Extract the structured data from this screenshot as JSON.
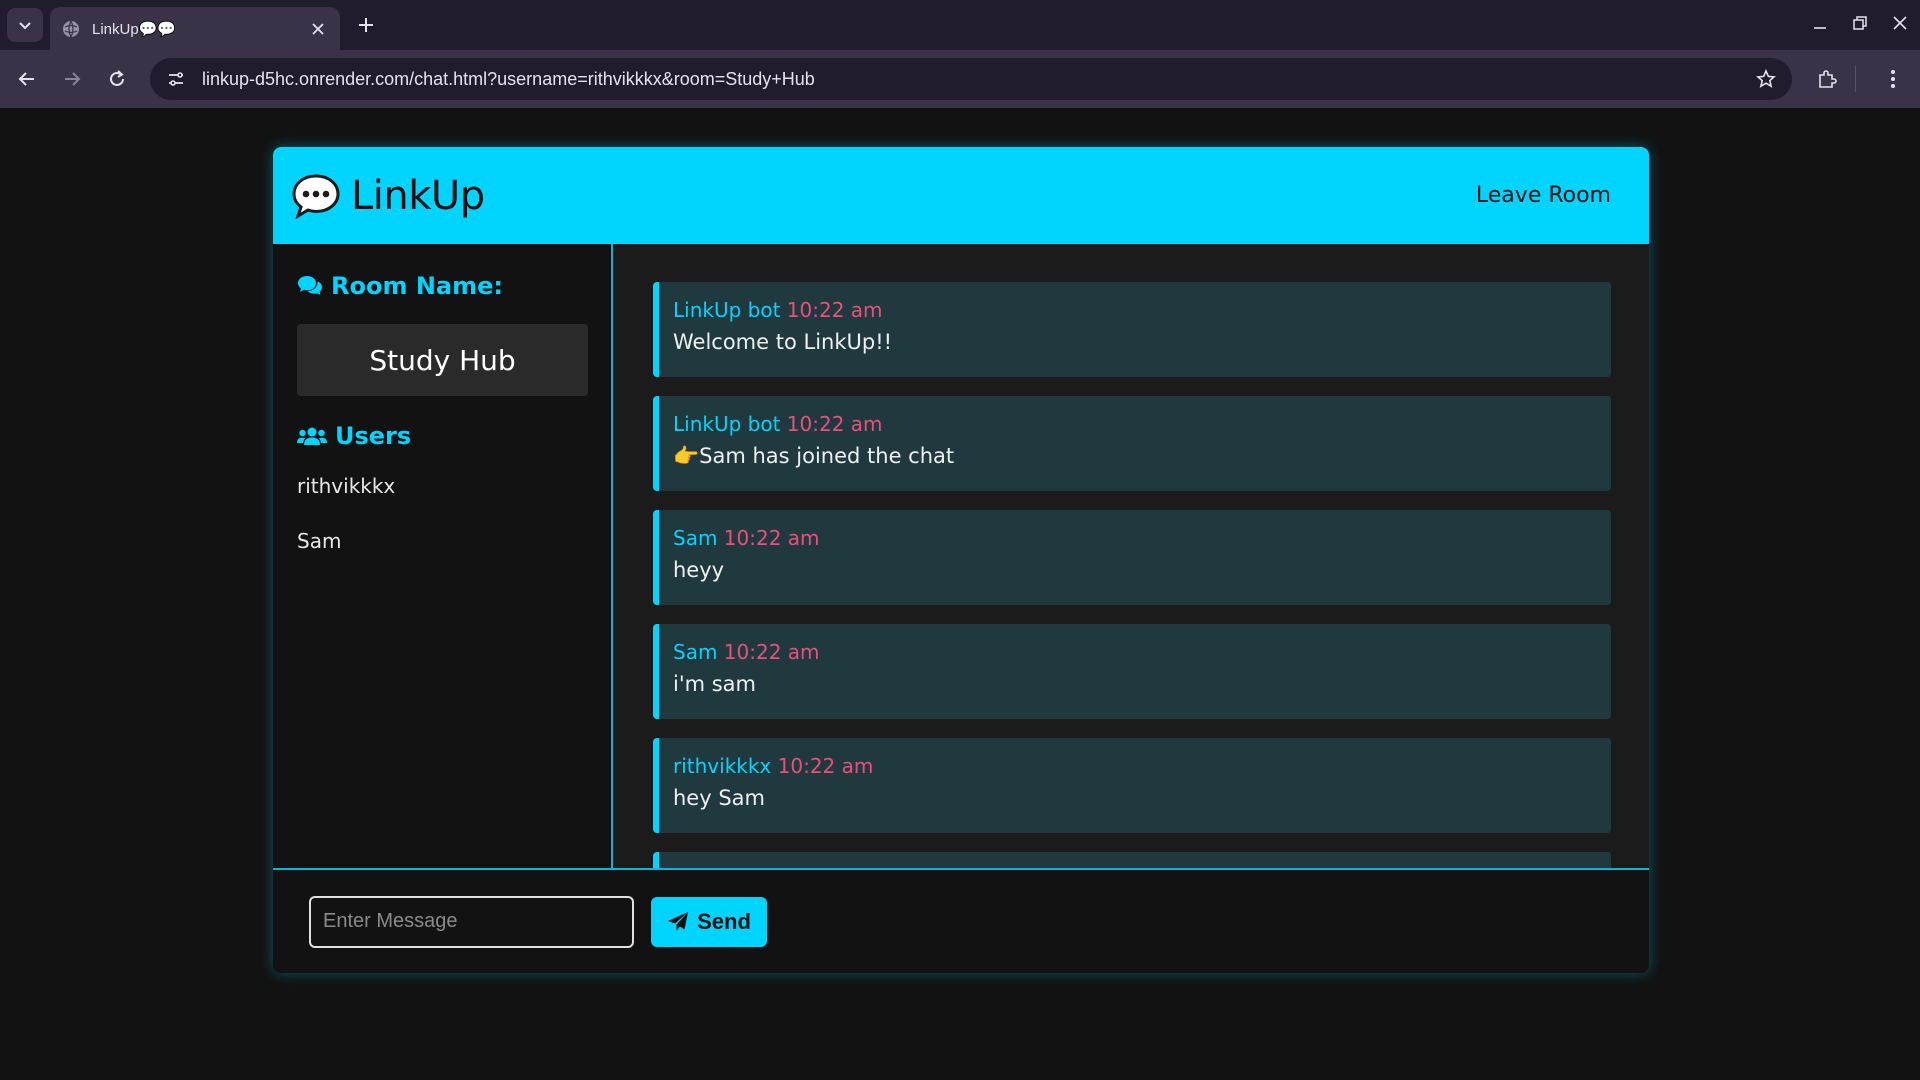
{
  "browser": {
    "tab_title": "LinkUp💬💬",
    "url": "linkup-d5hc.onrender.com/chat.html?username=rithvikkkx&room=Study+Hub"
  },
  "app": {
    "title": "LinkUp",
    "leave_label": "Leave Room",
    "accent_color": "#00d4ff",
    "time_color": "#ec4f7b"
  },
  "sidebar": {
    "room_heading": "Room Name:",
    "room_name": "Study Hub",
    "users_heading": "Users",
    "users": [
      "rithvikkkx",
      "Sam"
    ]
  },
  "messages": [
    {
      "author": "LinkUp bot",
      "time": "10:22 am",
      "text": "Welcome to LinkUp!!"
    },
    {
      "author": "LinkUp bot",
      "time": "10:22 am",
      "text": "👉Sam has joined the chat"
    },
    {
      "author": "Sam",
      "time": "10:22 am",
      "text": "heyy"
    },
    {
      "author": "Sam",
      "time": "10:22 am",
      "text": "i'm sam"
    },
    {
      "author": "rithvikkkx",
      "time": "10:22 am",
      "text": "hey Sam"
    },
    {
      "author": "",
      "time": "",
      "text": ""
    }
  ],
  "composer": {
    "placeholder": "Enter Message",
    "value": "",
    "send_label": "Send"
  }
}
